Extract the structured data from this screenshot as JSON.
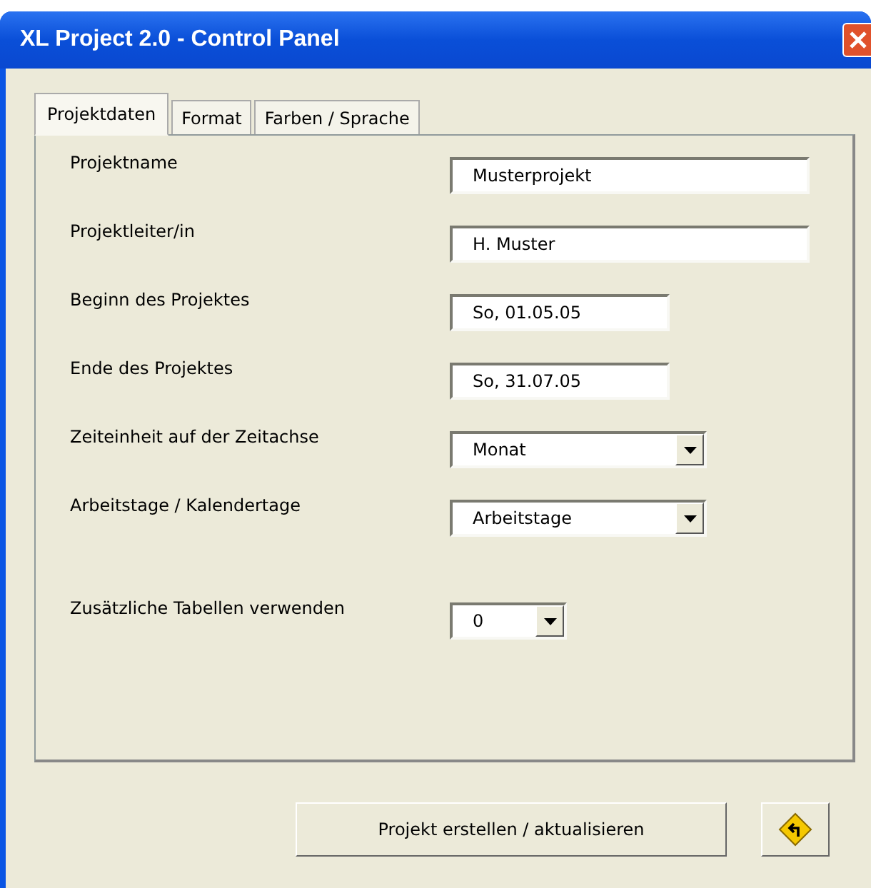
{
  "window": {
    "title": "XL Project 2.0 - Control Panel"
  },
  "tabs": [
    {
      "label": "Projektdaten",
      "selected": true
    },
    {
      "label": "Format",
      "selected": false
    },
    {
      "label": "Farben / Sprache",
      "selected": false
    }
  ],
  "fields": [
    {
      "label": "Projektname",
      "kind": "text",
      "value": "Musterprojekt"
    },
    {
      "label": "Projektleiter/in",
      "kind": "text",
      "value": "H. Muster"
    },
    {
      "label": "Beginn des Projektes",
      "kind": "text",
      "value": "So, 01.05.05"
    },
    {
      "label": "Ende des Projektes",
      "kind": "text",
      "value": "So, 31.07.05"
    },
    {
      "label": "Zeiteinheit auf der Zeitachse",
      "kind": "combo",
      "value": "Monat"
    },
    {
      "label": "Arbeitstage / Kalendertage",
      "kind": "combo",
      "value": "Arbeitstage"
    },
    {
      "label": "Zusätzliche Tabellen verwenden",
      "kind": "combo",
      "value": "0"
    }
  ],
  "buttons": {
    "primary": "Projekt erstellen / aktualisieren"
  }
}
